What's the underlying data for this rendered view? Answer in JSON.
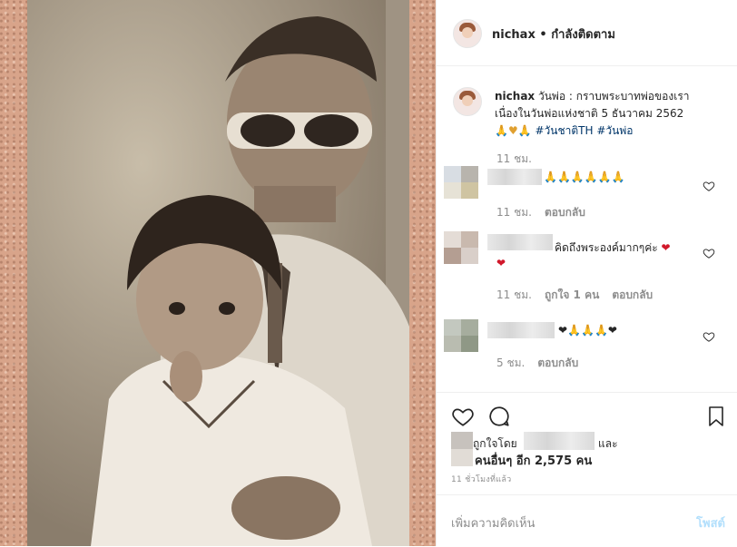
{
  "post": {
    "username": "nichax",
    "separator": "•",
    "follow_status": "กำลังติดตาม"
  },
  "caption": {
    "username": "nichax",
    "text_line1": "วันพ่อ : กราบพระบาทพ่อของเรา",
    "text_line2": "เนื่องในวันพ่อแห่งชาติ 5 ธันวาคม 2562",
    "emojis": "🙏♥🙏",
    "hashtag1": "#วันชาติTH",
    "hashtag2": "#วันพ่อ",
    "time": "11 ชม."
  },
  "comments": [
    {
      "text": "🙏🙏🙏🙏🙏🙏",
      "time": "11 ชม.",
      "likes": "",
      "reply": "ตอบกลับ"
    },
    {
      "text": "คิดถึงพระองค์มากๆค่ะ",
      "text_suffix": "❤",
      "time": "11 ชม.",
      "likes": "ถูกใจ 1 คน",
      "reply": "ตอบกลับ"
    },
    {
      "text": "❤🙏🙏🙏❤",
      "time": "5 ชม.",
      "likes": "",
      "reply": "ตอบกลับ"
    }
  ],
  "likes": {
    "liked_by": "ถูกใจโดย",
    "and": "และ",
    "others": "คนอื่นๆ อีก 2,575 คน"
  },
  "timestamp": "11 ชั่วโมงที่แล้ว",
  "add_comment": {
    "placeholder": "เพิ่มความคิดเห็น",
    "post_label": "โพสต์"
  },
  "icons": [
    "heart-icon",
    "comment-icon",
    "bookmark-icon"
  ]
}
